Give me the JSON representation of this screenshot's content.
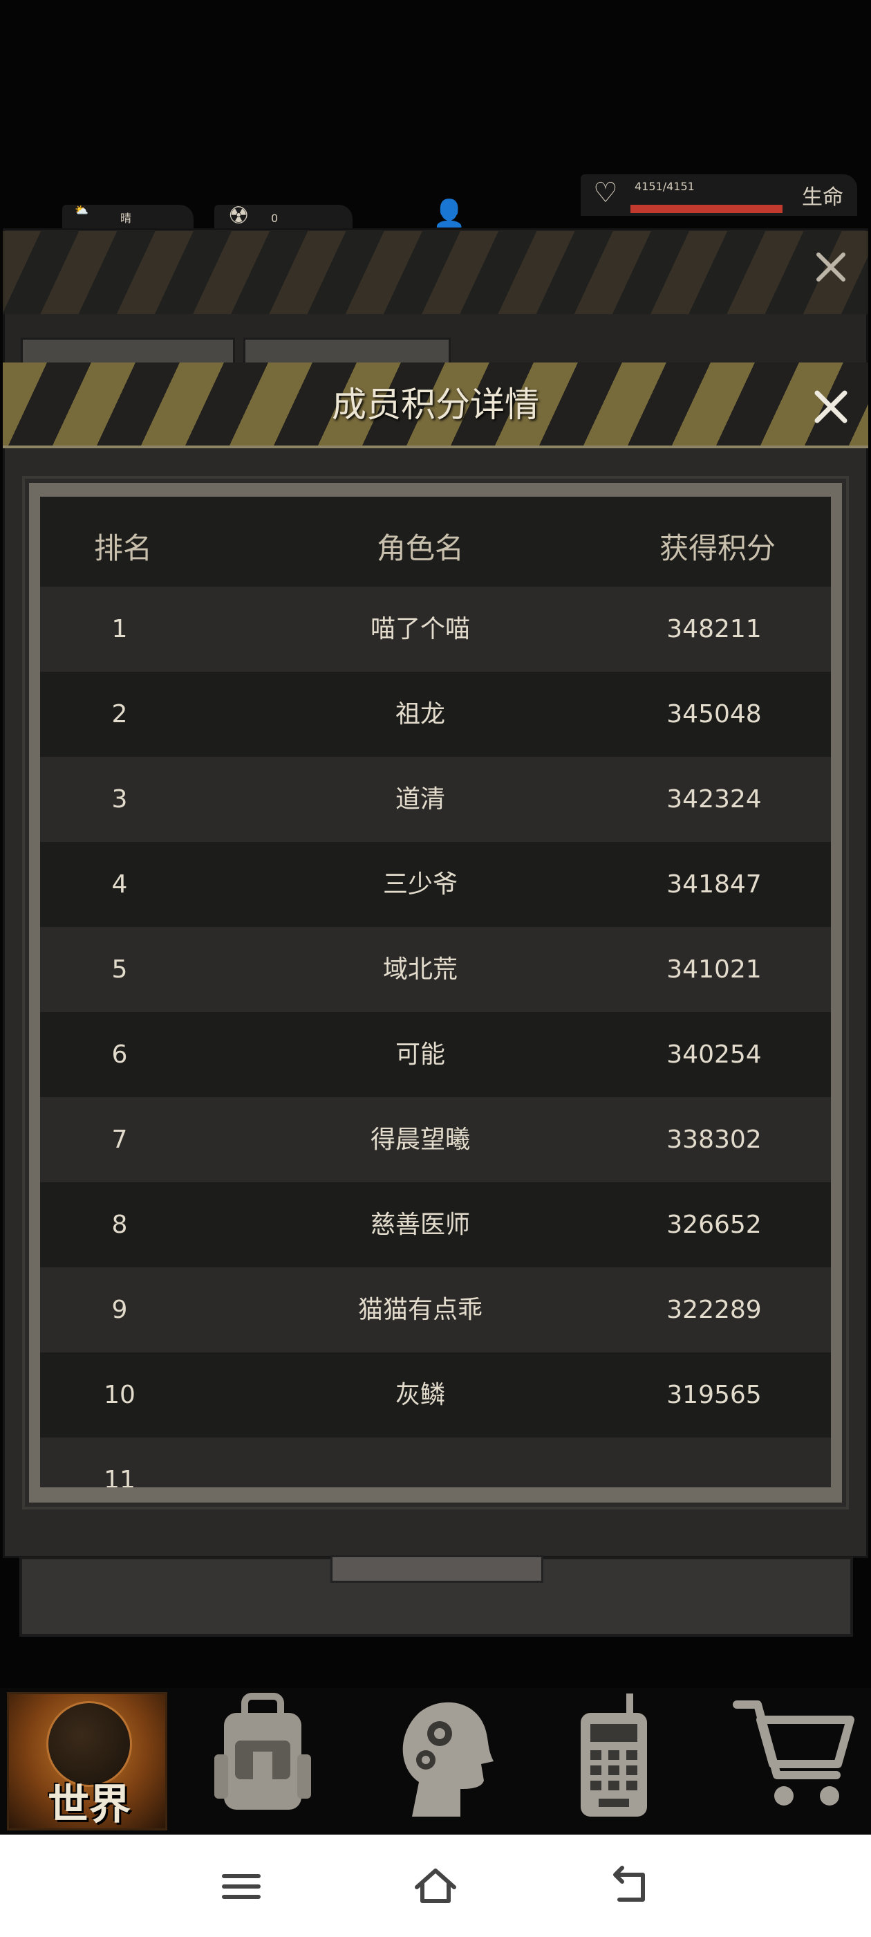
{
  "hud": {
    "weather": "晴",
    "radiation": "0",
    "hp_text": "4151/4151",
    "hp_label": "生命",
    "hp_fraction": 1.0
  },
  "modal": {
    "title": "成员积分详情",
    "columns": {
      "rank": "排名",
      "name": "角色名",
      "score": "获得积分"
    },
    "rows": [
      {
        "rank": "1",
        "name": "喵了个喵",
        "score": "348211"
      },
      {
        "rank": "2",
        "name": "祖龙",
        "score": "345048"
      },
      {
        "rank": "3",
        "name": "道清",
        "score": "342324"
      },
      {
        "rank": "4",
        "name": "三少爷",
        "score": "341847"
      },
      {
        "rank": "5",
        "name": "域北荒",
        "score": "341021"
      },
      {
        "rank": "6",
        "name": "可能",
        "score": "340254"
      },
      {
        "rank": "7",
        "name": "得晨望曦",
        "score": "338302"
      },
      {
        "rank": "8",
        "name": "慈善医师",
        "score": "326652"
      },
      {
        "rank": "9",
        "name": "猫猫有点乖",
        "score": "322289"
      },
      {
        "rank": "10",
        "name": "灰鳞",
        "score": "319565"
      },
      {
        "rank": "11",
        "name": "",
        "score": ""
      }
    ]
  },
  "nav": {
    "world_label": "世界",
    "items": [
      "globe-icon",
      "backpack-icon",
      "head-gears-icon",
      "radio-icon",
      "cart-icon"
    ]
  },
  "colors": {
    "accent_stripe": "#a89448",
    "hp_bar": "#c23a2e",
    "world_tab": "#c77a2a"
  }
}
